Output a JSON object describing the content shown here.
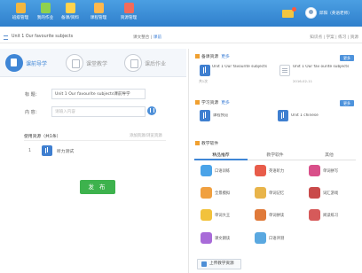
{
  "colors": {
    "topbar": "#3b8bd8",
    "accent": "#3f86d6",
    "publish": "#3db24d",
    "section_icon": "#f0a030"
  },
  "topnav": {
    "items": [
      {
        "label": "班级管理",
        "icon": "class-icon",
        "color": "#f3b740"
      },
      {
        "label": "我的作业",
        "icon": "homework-icon",
        "color": "#8fd14f"
      },
      {
        "label": "备课/资料",
        "icon": "prepare-icon",
        "color": "#ffd34d"
      },
      {
        "label": "课程管理",
        "icon": "course-icon",
        "color": "#ffb84d"
      },
      {
        "label": "资源管理",
        "icon": "resource-icon",
        "color": "#f26b5b"
      }
    ],
    "user_name": "邱阳（英语老师）"
  },
  "breadcrumb": {
    "unit": "Unit 1 Our favourite subjects",
    "middle_prefix": "课文整合 |",
    "middle_link": "课前",
    "right": "知识点 | 学案 | 练习 | 资源"
  },
  "steps": [
    {
      "label": "课前导学",
      "icon": "pre-class-icon",
      "active": true
    },
    {
      "label": "课堂教学",
      "icon": "in-class-icon",
      "active": false
    },
    {
      "label": "课后作业",
      "icon": "after-class-icon",
      "active": false
    }
  ],
  "form": {
    "title_label": "标 题：",
    "title_value": "Unit 1 Our favourite subjects课前导学",
    "content_label": "内 容：",
    "content_placeholder": "请输入内容"
  },
  "resources": {
    "label": "使用资源（共1条）",
    "link": "添加资源/浏览资源",
    "items": [
      {
        "num": "1",
        "name": "听力测试"
      }
    ]
  },
  "publish_label": "发 布",
  "sections": {
    "prep": {
      "title": "备课资源",
      "more": "更多",
      "tag": "更多",
      "items": [
        {
          "title": "Unit 1 Our favourite subjects",
          "sub": "共1次",
          "icon": "blue"
        },
        {
          "title": "Unit 1 Our fav ourite subjects",
          "sub": "2016-02-11",
          "icon": "doc"
        }
      ]
    },
    "study": {
      "title": "学习资源",
      "more": "更多",
      "tag": "更多",
      "items": [
        {
          "title": "课程预览",
          "sub": "",
          "icon": "blue"
        },
        {
          "title": "Unit 1 chinese",
          "sub": "",
          "icon": "blue"
        }
      ]
    },
    "software": {
      "title": "教学软件",
      "tabs": [
        "精品推荐",
        "教学软件",
        "其他"
      ],
      "apps": [
        {
          "name": "口语训练",
          "color": "#4aa3e8"
        },
        {
          "name": "英语听力",
          "color": "#e85c4a"
        },
        {
          "name": "单词拼写",
          "color": "#d94f8a"
        },
        {
          "name": "全景模拟",
          "color": "#f0a040"
        },
        {
          "name": "单词记忆",
          "color": "#e8b44a"
        },
        {
          "name": "词汇游戏",
          "color": "#c94a4a"
        },
        {
          "name": "单词大王",
          "color": "#f2c23c"
        },
        {
          "name": "单词拼读",
          "color": "#e07a3a"
        },
        {
          "name": "阅读练习",
          "color": "#d65a5a"
        },
        {
          "name": "课文朗读",
          "color": "#a86bd8"
        },
        {
          "name": "口语评测",
          "color": "#5aa8e0"
        }
      ]
    }
  },
  "bottom_button": "上传教学资源"
}
